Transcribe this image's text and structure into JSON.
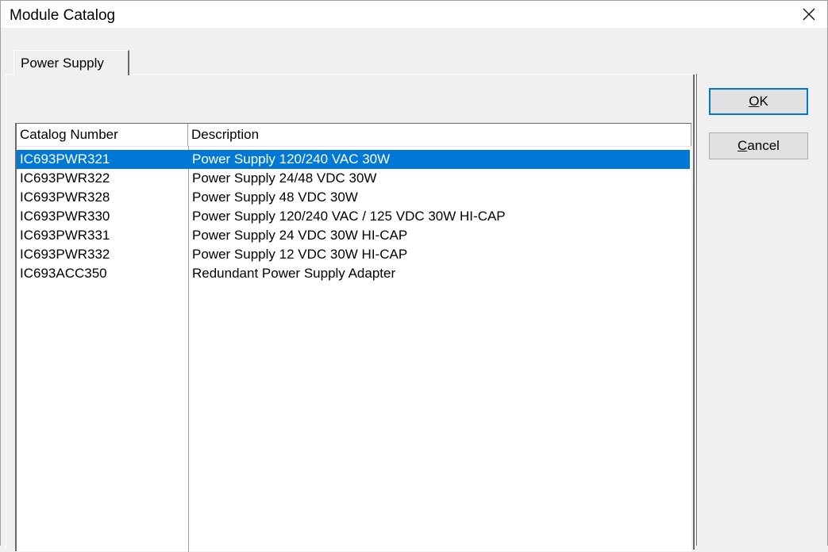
{
  "window": {
    "title": "Module Catalog",
    "close_icon": "close-icon"
  },
  "tabs": [
    {
      "label": "Power Supply",
      "active": true
    }
  ],
  "list": {
    "columns": [
      "Catalog Number",
      "Description"
    ],
    "rows": [
      {
        "catalog": "IC693PWR321",
        "description": "Power Supply 120/240 VAC 30W",
        "selected": true
      },
      {
        "catalog": "IC693PWR322",
        "description": "Power Supply 24/48 VDC 30W",
        "selected": false
      },
      {
        "catalog": "IC693PWR328",
        "description": "Power Supply 48 VDC 30W",
        "selected": false
      },
      {
        "catalog": "IC693PWR330",
        "description": "Power Supply 120/240 VAC / 125 VDC 30W HI-CAP",
        "selected": false
      },
      {
        "catalog": "IC693PWR331",
        "description": "Power Supply 24 VDC 30W HI-CAP",
        "selected": false
      },
      {
        "catalog": "IC693PWR332",
        "description": "Power Supply 12 VDC 30W HI-CAP",
        "selected": false
      },
      {
        "catalog": "IC693ACC350",
        "description": "Redundant Power Supply Adapter",
        "selected": false
      }
    ],
    "selection_color": "#0078d7"
  },
  "buttons": {
    "ok_first": "O",
    "ok_rest": "K",
    "cancel_first": "C",
    "cancel_rest": "ancel"
  }
}
